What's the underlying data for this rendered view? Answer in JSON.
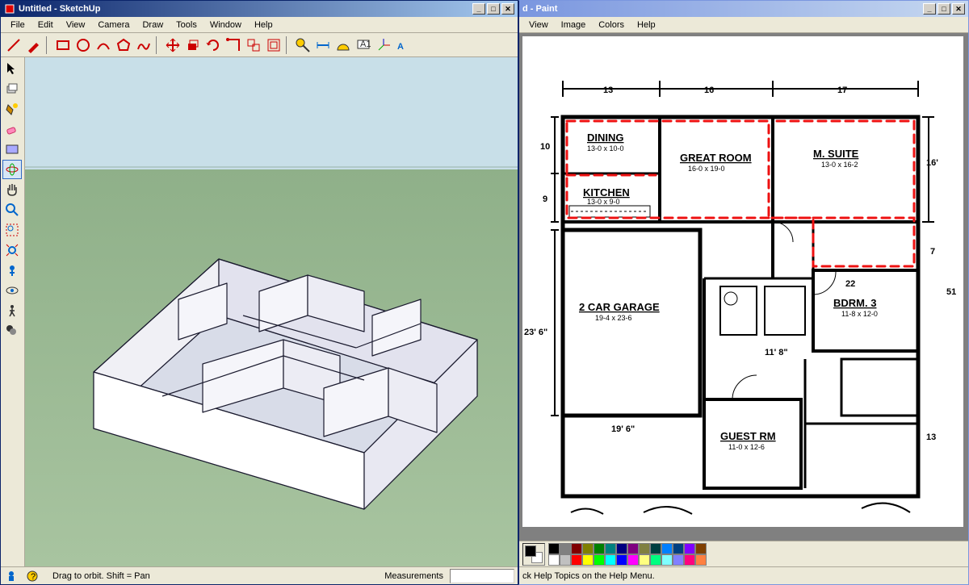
{
  "sketchup": {
    "title": "Untitled - SketchUp",
    "menus": [
      "File",
      "Edit",
      "View",
      "Camera",
      "Draw",
      "Tools",
      "Window",
      "Help"
    ],
    "toolbar_icons": [
      "line",
      "eraser",
      "select",
      "paint",
      "rectangle",
      "circle",
      "arc",
      "polygon",
      "move",
      "rotate",
      "scale",
      "offset",
      "tape",
      "protractor",
      "dimension",
      "text",
      "axes",
      "orbit",
      "pan",
      "zoom",
      "zoom-extents",
      "section",
      "walk"
    ],
    "side_tools": [
      "select",
      "component",
      "paint",
      "eraser",
      "rectangle",
      "orbit",
      "pan",
      "zoom",
      "zoom-window",
      "zoom-extents",
      "position-camera",
      "look-around",
      "walk",
      "section",
      "shadows"
    ],
    "status_hint": "Drag to orbit.  Shift = Pan",
    "status_label_measure": "Measurements"
  },
  "paint": {
    "title": "d - Paint",
    "menus": [
      "View",
      "Image",
      "Colors",
      "Help"
    ],
    "status": "ck Help Topics on the Help Menu.",
    "palette_top": [
      "#000000",
      "#808080",
      "#800000",
      "#808000",
      "#008000",
      "#008080",
      "#000080",
      "#800080",
      "#808040",
      "#004040",
      "#0080ff",
      "#004080",
      "#8000ff",
      "#804000"
    ],
    "palette_bottom": [
      "#ffffff",
      "#c0c0c0",
      "#ff0000",
      "#ffff00",
      "#00ff00",
      "#00ffff",
      "#0000ff",
      "#ff00ff",
      "#ffff80",
      "#00ff80",
      "#80ffff",
      "#8080ff",
      "#ff0080",
      "#ff8040"
    ]
  },
  "floorplan": {
    "rooms": {
      "dining": {
        "label": "DINING",
        "dim": "13-0 x 10-0"
      },
      "great": {
        "label": "GREAT ROOM",
        "dim": "16-0 x 19-0"
      },
      "msuite": {
        "label": "M. SUITE",
        "dim": "13-0 x 16-2"
      },
      "kitchen": {
        "label": "KITCHEN",
        "dim": "13-0 x 9-0"
      },
      "garage": {
        "label": "2 CAR GARAGE",
        "dim": "19-4 x 23-6"
      },
      "bdrm3": {
        "label": "BDRM. 3",
        "dim": "11-8 x 12-0"
      },
      "guest": {
        "label": "GUEST RM",
        "dim": "11-0 x 12-6"
      }
    },
    "hand_dims": {
      "top1": "13",
      "top2": "16",
      "top3": "17",
      "left1": "10",
      "left2": "9",
      "left3": "23' 6\"",
      "right1": "16'",
      "right2": "7",
      "bottom1": "19' 6\"",
      "mid1": "11' 8\"",
      "r_22": "22",
      "r_13_4": "13",
      "far_right": "51"
    }
  }
}
